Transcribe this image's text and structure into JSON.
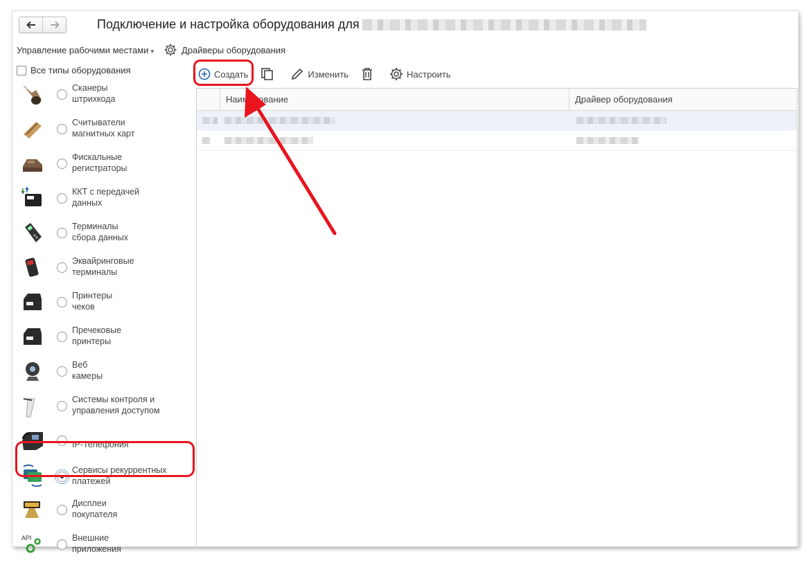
{
  "window": {
    "title": "Подключение и настройка оборудования для"
  },
  "nav": {
    "back_icon": "arrow-left-icon",
    "forward_icon": "arrow-right-icon"
  },
  "menu": {
    "workplaces_label": "Управление рабочими местами",
    "drivers_label": "Драйверы оборудования"
  },
  "left": {
    "all_types_label": "Все типы оборудования",
    "device_types": [
      {
        "label": "Сканеры\nштрихкода",
        "icon": "barcode-scanner-icon",
        "selected": false
      },
      {
        "label": "Считыватели\nмагнитных карт",
        "icon": "card-reader-icon",
        "selected": false
      },
      {
        "label": "Фискальные\nрегистраторы",
        "icon": "fiscal-register-icon",
        "selected": false
      },
      {
        "label": "ККТ с передачей\nданных",
        "icon": "online-cash-register-icon",
        "selected": false
      },
      {
        "label": "Терминалы\nсбора данных",
        "icon": "data-terminal-icon",
        "selected": false
      },
      {
        "label": "Эквайринговые\nтерминалы",
        "icon": "acquiring-terminal-icon",
        "selected": false
      },
      {
        "label": "Принтеры\nчеков",
        "icon": "receipt-printer-icon",
        "selected": false
      },
      {
        "label": "Пречековые\nпринтеры",
        "icon": "pre-receipt-printer-icon",
        "selected": false
      },
      {
        "label": "Веб\nкамеры",
        "icon": "webcam-icon",
        "selected": false
      },
      {
        "label": "Системы контроля и\nуправления доступом",
        "icon": "turnstile-icon",
        "selected": false
      },
      {
        "label": "IP-Телефония",
        "icon": "ip-phone-icon",
        "selected": false
      },
      {
        "label": "Сервисы рекуррентных\nплатежей",
        "icon": "recurring-payments-icon",
        "selected": true
      },
      {
        "label": "Дисплеи\nпокупателя",
        "icon": "customer-display-icon",
        "selected": false
      },
      {
        "label": "Внешние\nприложения",
        "icon": "api-gear-icon",
        "selected": false
      }
    ]
  },
  "toolbar": {
    "create_label": "Создать",
    "edit_label": "Изменить",
    "configure_label": "Настроить"
  },
  "table": {
    "columns": [
      "Наименование",
      "Драйвер оборудования"
    ]
  },
  "accent": {
    "annotation_red": "#e8141e",
    "selection_blue": "#edf2fa"
  }
}
